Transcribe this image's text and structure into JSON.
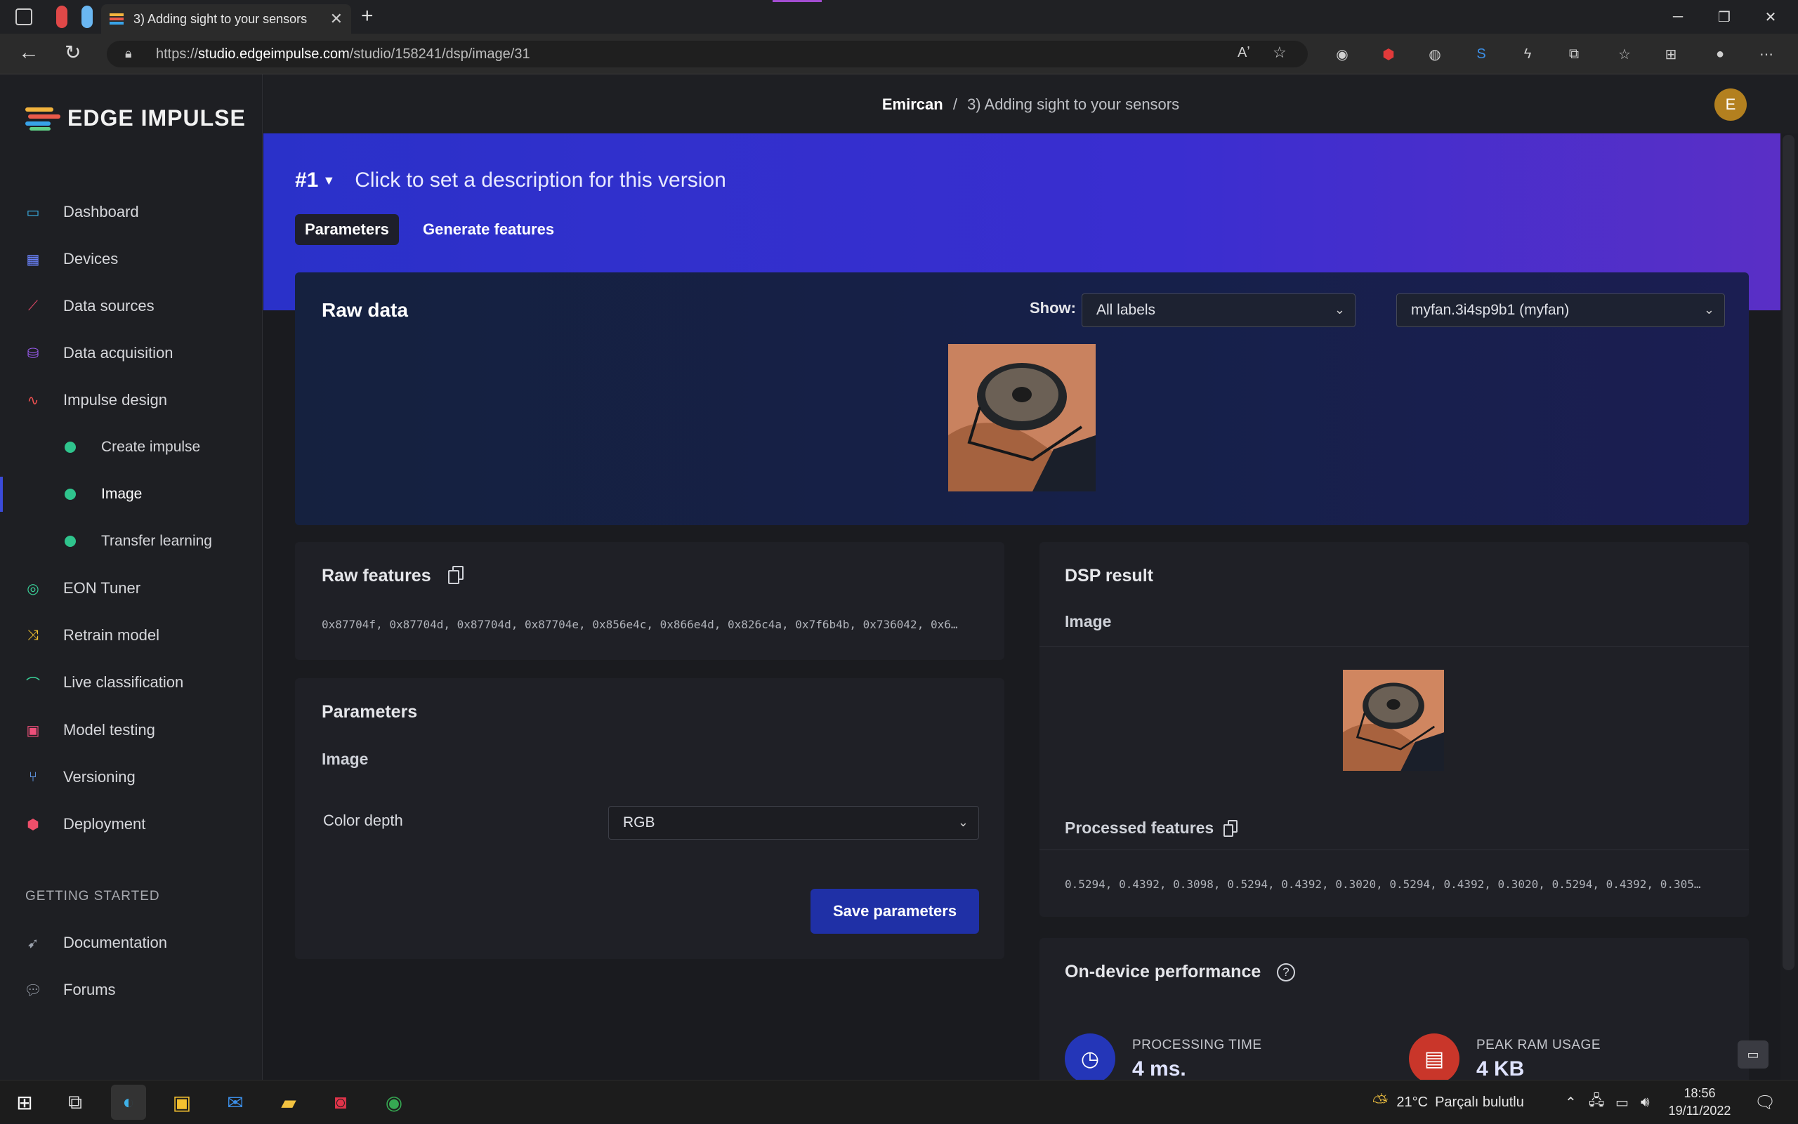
{
  "browser": {
    "tab_title": "3) Adding sight to your sensors",
    "url_domain": "studio.edgeimpulse.com",
    "url_prefix": "https://",
    "url_path": "/studio/158241/dsp/image/31"
  },
  "sidebar": {
    "logo_text": "EDGE IMPULSE",
    "items": [
      {
        "label": "Dashboard"
      },
      {
        "label": "Devices"
      },
      {
        "label": "Data sources"
      },
      {
        "label": "Data acquisition"
      },
      {
        "label": "Impulse design"
      },
      {
        "label": "Create impulse"
      },
      {
        "label": "Image"
      },
      {
        "label": "Transfer learning"
      },
      {
        "label": "EON Tuner"
      },
      {
        "label": "Retrain model"
      },
      {
        "label": "Live classification"
      },
      {
        "label": "Model testing"
      },
      {
        "label": "Versioning"
      },
      {
        "label": "Deployment"
      }
    ],
    "section_label": "GETTING STARTED",
    "bottom_items": [
      {
        "label": "Documentation"
      },
      {
        "label": "Forums"
      }
    ]
  },
  "header": {
    "owner": "Emircan",
    "separator": "/",
    "project": "3) Adding sight to your sensors",
    "avatar_letter": "E"
  },
  "version": {
    "number": "#1",
    "description": "Click to set a description for this version"
  },
  "tabs": [
    {
      "label": "Parameters",
      "active": true
    },
    {
      "label": "Generate features",
      "active": false
    }
  ],
  "raw_data": {
    "title": "Raw data",
    "show_label": "Show:",
    "filter_value": "All labels",
    "sample_value": "myfan.3i4sp9b1 (myfan)"
  },
  "raw_features": {
    "title": "Raw features",
    "values": "0x87704f, 0x87704d, 0x87704d, 0x87704e, 0x856e4c, 0x866e4d, 0x826c4a, 0x7f6b4b, 0x736042, 0x6…"
  },
  "parameters": {
    "title": "Parameters",
    "subtitle": "Image",
    "color_depth_label": "Color depth",
    "color_depth_value": "RGB",
    "save_label": "Save parameters"
  },
  "dsp_result": {
    "title": "DSP result",
    "subtitle": "Image",
    "processed_title": "Processed features",
    "processed_values": "0.5294, 0.4392, 0.3098, 0.5294, 0.4392, 0.3020, 0.5294, 0.4392, 0.3020, 0.5294, 0.4392, 0.305…"
  },
  "performance": {
    "title": "On-device performance",
    "processing_label": "PROCESSING TIME",
    "processing_value": "4 ms.",
    "ram_label": "PEAK RAM USAGE",
    "ram_value": "4 KB"
  },
  "taskbar": {
    "weather_temp": "21°C",
    "weather_text": "Parçalı bulutlu",
    "time": "18:56",
    "date": "19/11/2022"
  },
  "colors": {
    "accent": "#3b4bd9",
    "hero_start": "#2a31c9",
    "hero_end": "#5a2fc6",
    "active_dot": "#2fc48d",
    "button": "#1f30a6"
  }
}
